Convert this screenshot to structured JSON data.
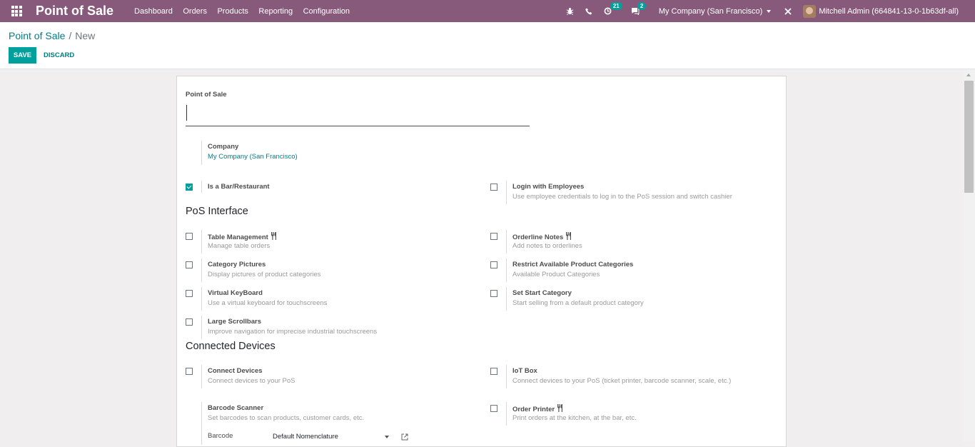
{
  "navbar": {
    "apps_icon": "grid-icon",
    "brand": "Point of Sale",
    "menu": [
      "Dashboard",
      "Orders",
      "Products",
      "Reporting",
      "Configuration"
    ],
    "activity_count": "21",
    "messages_count": "2",
    "company": "My Company (San Francisco)",
    "user": "Mitchell Admin (664841-13-0-1b63df-all)"
  },
  "breadcrumb": {
    "parent": "Point of Sale",
    "separator": "/",
    "current": "New"
  },
  "buttons": {
    "save": "SAVE",
    "discard": "DISCARD"
  },
  "form": {
    "name_label": "Point of Sale",
    "name_value": "",
    "company_label": "Company",
    "company_value": "My Company (San Francisco)",
    "is_bar": {
      "label": "Is a Bar/Restaurant",
      "checked": true
    },
    "login_employees": {
      "label": "Login with Employees",
      "help": "Use employee credentials to log in to the PoS session and switch cashier",
      "checked": false
    },
    "pos_interface_title": "PoS Interface",
    "table_management": {
      "label": "Table Management",
      "help": "Manage table orders",
      "checked": false
    },
    "orderline_notes": {
      "label": "Orderline Notes",
      "help": "Add notes to orderlines",
      "checked": false
    },
    "category_pictures": {
      "label": "Category Pictures",
      "help": "Display pictures of product categories",
      "checked": false
    },
    "restrict_categories": {
      "label": "Restrict Available Product Categories",
      "help": "Available Product Categories",
      "checked": false
    },
    "virtual_keyboard": {
      "label": "Virtual KeyBoard",
      "help": "Use a virtual keyboard for touchscreens",
      "checked": false
    },
    "start_category": {
      "label": "Set Start Category",
      "help": "Start selling from a default product category",
      "checked": false
    },
    "large_scrollbars": {
      "label": "Large Scrollbars",
      "help": "Improve navigation for imprecise industrial touchscreens",
      "checked": false
    },
    "connected_devices_title": "Connected Devices",
    "connect_devices": {
      "label": "Connect Devices",
      "help": "Connect devices to your PoS",
      "checked": false
    },
    "iot_box": {
      "label": "IoT Box",
      "help": "Connect devices to your PoS (ticket printer, barcode scanner, scale, etc.)",
      "checked": false
    },
    "barcode_scanner": {
      "label": "Barcode Scanner",
      "help": "Set barcodes to scan products, customer cards, etc."
    },
    "order_printer": {
      "label": "Order Printer",
      "help": "Print orders at the kitchen, at the bar, etc.",
      "checked": false
    },
    "barcode_label": "Barcode",
    "barcode_value": "Default Nomenclature"
  },
  "colors": {
    "navbar": "#875a7b",
    "primary": "#00a09d",
    "link": "#017e84"
  }
}
